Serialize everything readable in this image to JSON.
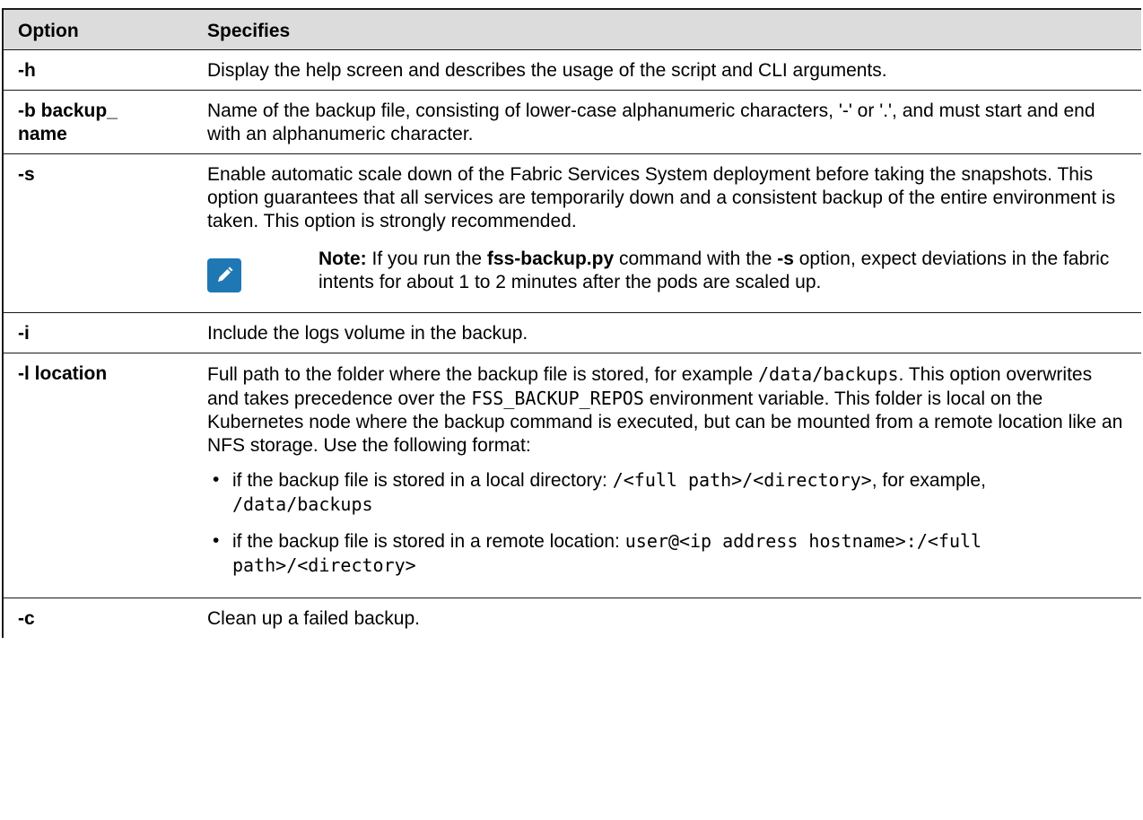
{
  "header": {
    "option": "Option",
    "specifies": "Specifies"
  },
  "rows": [
    {
      "option": "-h",
      "text": "Display the help screen and describes the usage of the script and CLI arguments."
    },
    {
      "option": "-b backup_\nname",
      "text": "Name of the backup file, consisting of lower-case alphanumeric characters, '-' or '.', and must start and end with an alphanumeric character."
    },
    {
      "option": "-s",
      "text": "Enable automatic scale down of the Fabric Services System deployment before taking the snapshots. This option guarantees that all services are temporarily down and a consistent backup of the entire environment is taken. This option is strongly recommended.",
      "note": {
        "label": "Note:",
        "t1": " If you run the ",
        "cmd": "fss-backup.py",
        "t2": " command with the ",
        "flag": "-s",
        "t3": " option, expect deviations in the fabric intents for about 1 to 2 minutes after the pods are scaled up."
      }
    },
    {
      "option": "-i",
      "text": "Include the logs volume in the backup."
    },
    {
      "option": "-l location",
      "t1": "Full path to the folder where the backup file is stored, for example ",
      "c1": "/data/backups",
      "t2": ". This option overwrites and takes precedence over the ",
      "c2": "FSS_BACKUP_REPOS",
      "t3": " environment variable. This folder is local on the Kubernetes node where the backup command is executed, but can be mounted from a remote location like an NFS storage. Use the following format:",
      "bullets": [
        {
          "t1": "if the backup file is stored in a local directory: ",
          "c1": "/<full path>/<directory>",
          "t2": ", for example, ",
          "c2": "/data/backups"
        },
        {
          "t1": "if the backup file is stored in a remote location: ",
          "c1": "user@<ip address hostname>:/<full path>/<directory>"
        }
      ]
    },
    {
      "option": "-c",
      "text": "Clean up a failed backup."
    }
  ],
  "colors": {
    "header_bg": "#dcdcdc",
    "note_icon_bg": "#1f78b4",
    "border": "#1a1a1a"
  },
  "icons": {
    "note": "pencil-note-icon"
  }
}
